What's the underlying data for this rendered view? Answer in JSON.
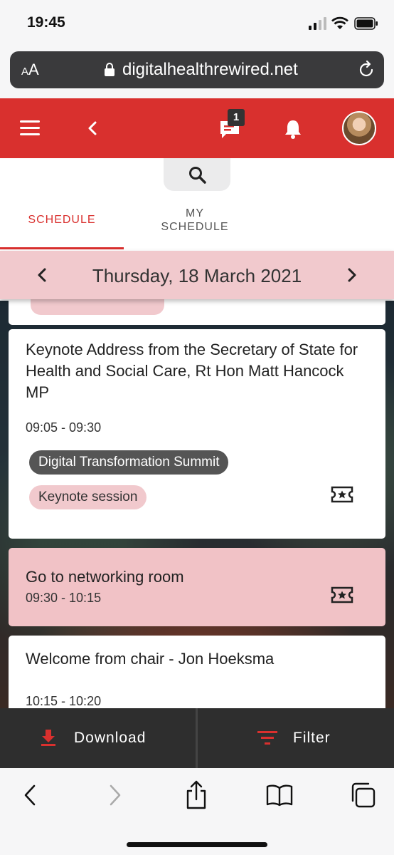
{
  "status_bar": {
    "time": "19:45"
  },
  "browser": {
    "text_size_button": "AA",
    "url": "digitalhealthrewired.net"
  },
  "header": {
    "message_count": "1"
  },
  "tabs": {
    "schedule": "SCHEDULE",
    "my_schedule_line1": "MY",
    "my_schedule_line2": "SCHEDULE"
  },
  "date_nav": {
    "date": "Thursday, 18 March 2021"
  },
  "sessions": [
    {
      "title": "Keynote Address from the Secretary of State for Health and Social Care, Rt Hon Matt Hancock MP",
      "time": "09:05 - 09:30",
      "tags": [
        "Digital Transformation Summit",
        "Keynote session"
      ]
    },
    {
      "title": "Go to networking room",
      "time": "09:30 - 10:15"
    },
    {
      "title": "Welcome from chair - Jon Hoeksma",
      "time": "10:15 - 10:20"
    }
  ],
  "actions": {
    "download": "Download",
    "filter": "Filter"
  },
  "colors": {
    "brand_red": "#d9302e",
    "pink": "#f1c9cd",
    "dark_bar": "#2e2e2e"
  },
  "icons": [
    "hamburger-icon",
    "back-icon",
    "message-icon",
    "bell-icon",
    "search-icon",
    "ticket-icon",
    "download-icon",
    "filter-icon",
    "lock-icon",
    "reload-icon"
  ]
}
